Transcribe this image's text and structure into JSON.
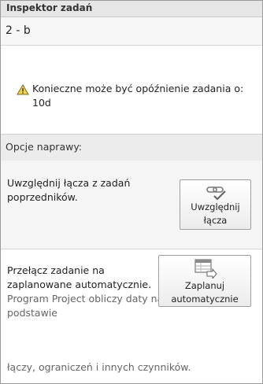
{
  "header": {
    "title": "Inspektor zadań"
  },
  "task": {
    "name": "2 - b"
  },
  "warning": {
    "icon": "warning-icon",
    "text": "Konieczne może być opóźnienie zadania o: 10d"
  },
  "repair": {
    "header": "Opcje naprawy:",
    "option1": {
      "text": "Uwzględnij łącza z zadań poprzedników.",
      "button_line1": "Uwzględnij",
      "button_line2": "łącza",
      "icon": "link-check-icon"
    },
    "option2": {
      "text": "Przełącz zadanie na zaplanowane automatycznie.",
      "desc": "Program Project obliczy daty na podstawie",
      "desc_tail": "łączy, ograniczeń i innych czynników.",
      "button_line1": "Zaplanuj",
      "button_line2": "automatycznie",
      "icon": "auto-schedule-icon"
    }
  }
}
